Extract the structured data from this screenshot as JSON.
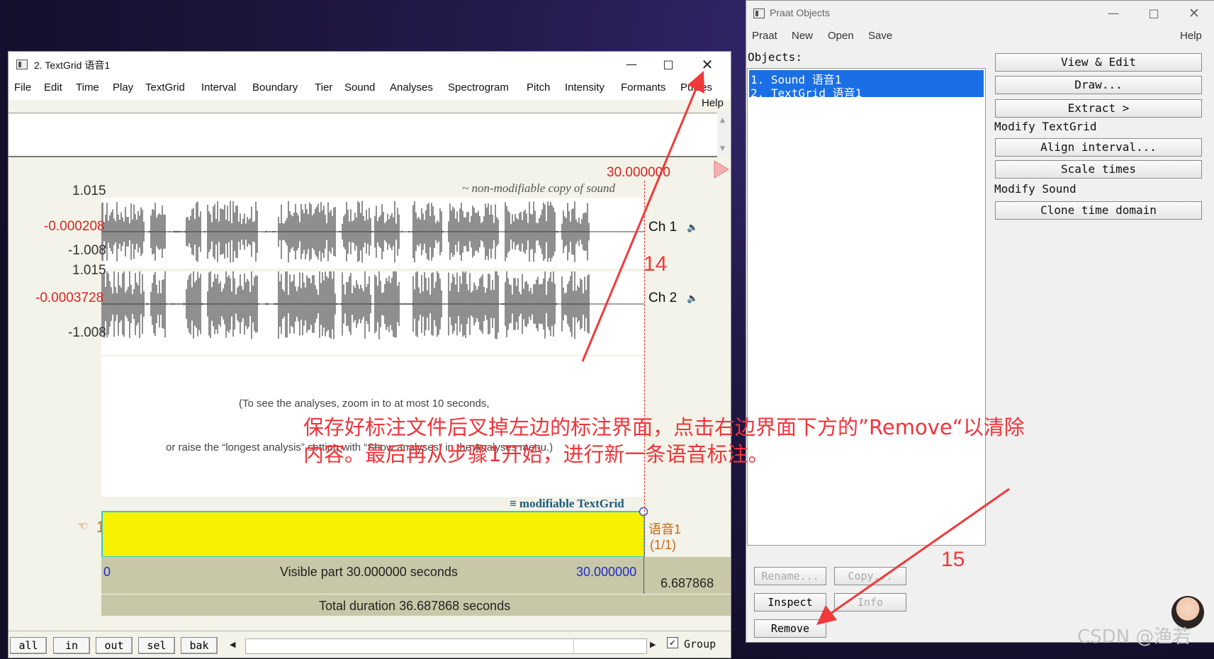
{
  "textgrid_window": {
    "title": "2. TextGrid 语音1",
    "menu": [
      "File",
      "Edit",
      "Time",
      "Play",
      "TextGrid",
      "Interval",
      "Boundary",
      "Tier",
      "Sound",
      "Analyses",
      "Spectrogram",
      "Pitch",
      "Intensity",
      "Formants",
      "Pulses"
    ],
    "help": "Help",
    "cursor_time": "30.000000",
    "sound_caption": "~ non-modifiable copy of sound",
    "ch1": {
      "top": "1.015",
      "mid": "-0.000208",
      "bottom": "-1.008",
      "label": "Ch 1"
    },
    "ch2": {
      "top": "1.015",
      "mid": "-0.0003728",
      "bottom": "-1.008",
      "label": "Ch 2"
    },
    "analysis_msg1": "(To see the analyses, zoom in to at most 10 seconds,",
    "analysis_msg2": "or raise the “longest analysis” setting with “Show analyses” in the Analyses menu.)",
    "textgrid_caption": "≡ modifiable TextGrid",
    "tier_number": "1",
    "tier_name": "语音1",
    "tier_count": "(1/1)",
    "visible_start": "0",
    "visible_label": "Visible part 30.000000 seconds",
    "visible_end": "30.000000",
    "remaining": "6.687868",
    "total_label": "Total duration 36.687868 seconds",
    "footer_buttons": [
      "all",
      "in",
      "out",
      "sel",
      "bak"
    ],
    "group_label": "Group"
  },
  "objects_window": {
    "title": "Praat Objects",
    "menu": [
      "Praat",
      "New",
      "Open",
      "Save"
    ],
    "help": "Help",
    "objects_label": "Objects:",
    "objects": [
      "1. Sound 语音1",
      "2. TextGrid 语音1"
    ],
    "view_edit": "View & Edit",
    "draw": "Draw...",
    "extract": "Extract  >",
    "modify_textgrid": "Modify TextGrid",
    "align_interval": "Align interval...",
    "scale_times": "Scale times",
    "modify_sound": "Modify Sound",
    "clone_time_domain": "Clone time domain",
    "rename": "Rename...",
    "copy": "Copy...",
    "inspect": "Inspect",
    "info": "Info",
    "remove": "Remove"
  },
  "annotations": {
    "step14": "14",
    "step15": "15",
    "note_line1": "保存好标注文件后叉掉左边的标注界面，点击右边界面下方的”Remove“以清除",
    "note_line2": "内容。最后再从步骤1开始，进行新一条语音标注。",
    "watermark": "CSDN @渔若"
  },
  "colors": {
    "annotation_red": "#f03a3a",
    "selection_blue": "#1b6fe6",
    "tier_yellow": "#f7f100",
    "tier_border": "#2ec9e6"
  }
}
